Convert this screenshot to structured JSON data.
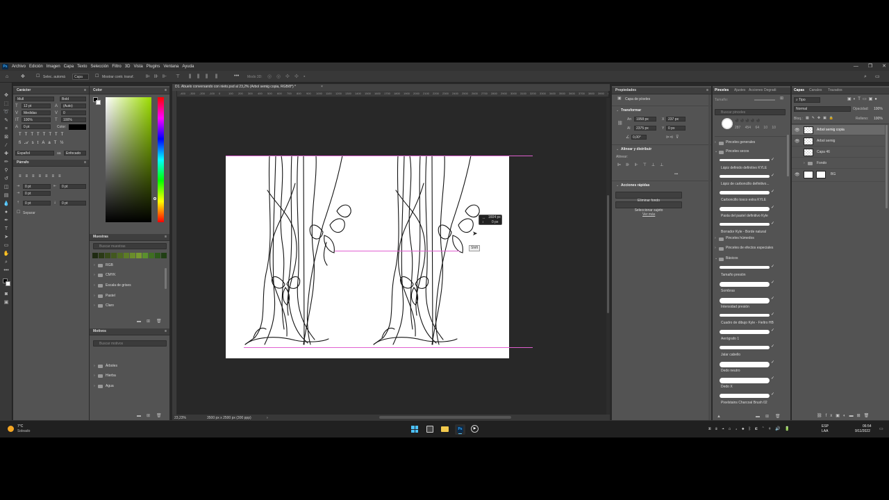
{
  "menu": {
    "items": [
      "Archivo",
      "Edición",
      "Imagen",
      "Capa",
      "Texto",
      "Selección",
      "Filtro",
      "3D",
      "Vista",
      "Plugins",
      "Ventana",
      "Ayuda"
    ]
  },
  "window_controls": [
    "—",
    "❐",
    "✕"
  ],
  "options_bar": {
    "auto_select": "Selec. automá",
    "auto_select_target": "Capa",
    "show_transform": "Mostrar contr. transf.",
    "mode_3d": "Modo 3D:"
  },
  "character_panel": {
    "title": "Carácter",
    "font_family": "Mull",
    "font_style": "Bold",
    "size": "12 pt",
    "leading": "(Auto)",
    "kerning": "Medidas",
    "tracking": "0",
    "vscale": "100%",
    "hscale": "100%",
    "baseline": "0 pt",
    "color_label": "Color:",
    "language": "Español",
    "antialias": "Enfocado"
  },
  "paragraph_panel": {
    "title": "Párrafo",
    "indent_left": "0 pt",
    "indent_right": "0 pt",
    "indent_first": "0 pt",
    "space_before": "0 pt",
    "space_after": "0 pt",
    "hyphenate": "Separar"
  },
  "color_panel": {
    "title": "Color"
  },
  "swatches_panel": {
    "title": "Muestras",
    "search_placeholder": "Buscar muestras",
    "groups": [
      "RGB",
      "CMYK",
      "Escala de grises",
      "Pastel",
      "Claro"
    ],
    "swatch_colors": [
      "#1f2a12",
      "#2b3a16",
      "#37491b",
      "#42581f",
      "#4f6a23",
      "#5d7c27",
      "#6a8c2b",
      "#77992f",
      "#5b8f2e",
      "#3f6f22",
      "#2d5a1b",
      "#203f14"
    ]
  },
  "patterns_panel": {
    "title": "Motivos",
    "search_placeholder": "Buscar motivos",
    "groups": [
      "Árboles",
      "Hierba",
      "Agua"
    ]
  },
  "document": {
    "tab_title": "D1. Abuelo conversando con nieto.psd al 23,2% (Arbol semig copia, RGB/8*) *",
    "zoom": "23,23%",
    "doc_info": "3500 px x 2500 px (300 ppp)",
    "ruler_labels": [
      "-400",
      "-300",
      "-200",
      "-100",
      "0",
      "100",
      "200",
      "300",
      "400",
      "500",
      "600",
      "700",
      "800",
      "900",
      "1000",
      "1100",
      "1200",
      "1300",
      "1400",
      "1500",
      "1600",
      "1700",
      "1800",
      "1900",
      "2000",
      "2100",
      "2200",
      "2300",
      "2400",
      "2500",
      "2600",
      "2700",
      "2800",
      "2900",
      "3000",
      "3100",
      "3200",
      "3300",
      "3400",
      "3500",
      "3600",
      "3700",
      "3800",
      "3900",
      "4000",
      "4100"
    ],
    "tooltip_w": "1604 px",
    "tooltip_h": "0 px",
    "cursor_hint": "Shift"
  },
  "properties_panel": {
    "title": "Propiedades",
    "layer_kind": "Capa de píxeles",
    "transform_title": "Transformar",
    "w": "1958 px",
    "h": "2375 px",
    "x": "237 px",
    "y": "0 px",
    "angle": "0,00°",
    "w_label": "An",
    "h_label": "Al",
    "x_label": "X",
    "y_label": "Y",
    "align_title": "Alinear y distribuir",
    "align_label": "Alinear:",
    "quick_actions_title": "Acciones rápidas",
    "remove_bg": "Eliminar fondo",
    "select_subject": "Seleccionar sujeto",
    "more": "Ver más"
  },
  "brushes_panel": {
    "tabs": [
      "Pinceles",
      "Ajustes",
      "Acciones",
      "Degradi"
    ],
    "size_label": "Tamaño:",
    "search_placeholder": "Buscar pinceles",
    "preset_sizes": [
      "287",
      "454",
      "64",
      "10",
      "10"
    ],
    "groups": [
      "Pinceles generales",
      "Pinceles secos",
      "Pinceles húmedos",
      "Pinceles de efectos especiales",
      "Básicos"
    ],
    "brushes": [
      "Lápiz definido definitivo KYLE",
      "Lápiz de carboncillo definitivo...",
      "Carboncillo tosco extra KYLE",
      "Pasta del pastel definitivo Kyle",
      "Borrador Kyle - Borde natural",
      "Tamaño presión",
      "Sombras",
      "Intensidad presión",
      "Cuadro de dibujo Kyle - Fieltro HB",
      "Aerógrafo 1",
      "Jalar cabello",
      "Dedo neutro",
      "Dedo X",
      "Pixelstains Charcoal Brush 02"
    ]
  },
  "layers_panel": {
    "tabs": [
      "Capas",
      "Canales",
      "Trazados"
    ],
    "filter_kind": "Tipo",
    "blend_mode": "Normal",
    "opacity_label": "Opacidad:",
    "opacity": "100%",
    "lock_label": "Bloq.:",
    "fill_label": "Relleno:",
    "fill": "100%",
    "layers": [
      {
        "name": "Arbol semig copia",
        "visible": true
      },
      {
        "name": "Arbol semig",
        "visible": true
      },
      {
        "name": "Capa 46",
        "visible": false
      },
      {
        "name": "Fondo",
        "visible": false
      },
      {
        "name": "BG",
        "visible": true
      }
    ]
  },
  "taskbar": {
    "weather_temp": "7°C",
    "weather_desc": "Soleado",
    "lang_top": "ESP",
    "lang_bottom": "LAA",
    "time": "06:54",
    "date": "9/11/2022"
  },
  "colors": {
    "ps_blue": "#31a8ff",
    "guide_magenta": "#e05fd0",
    "win_accent": "#0a84ff"
  }
}
